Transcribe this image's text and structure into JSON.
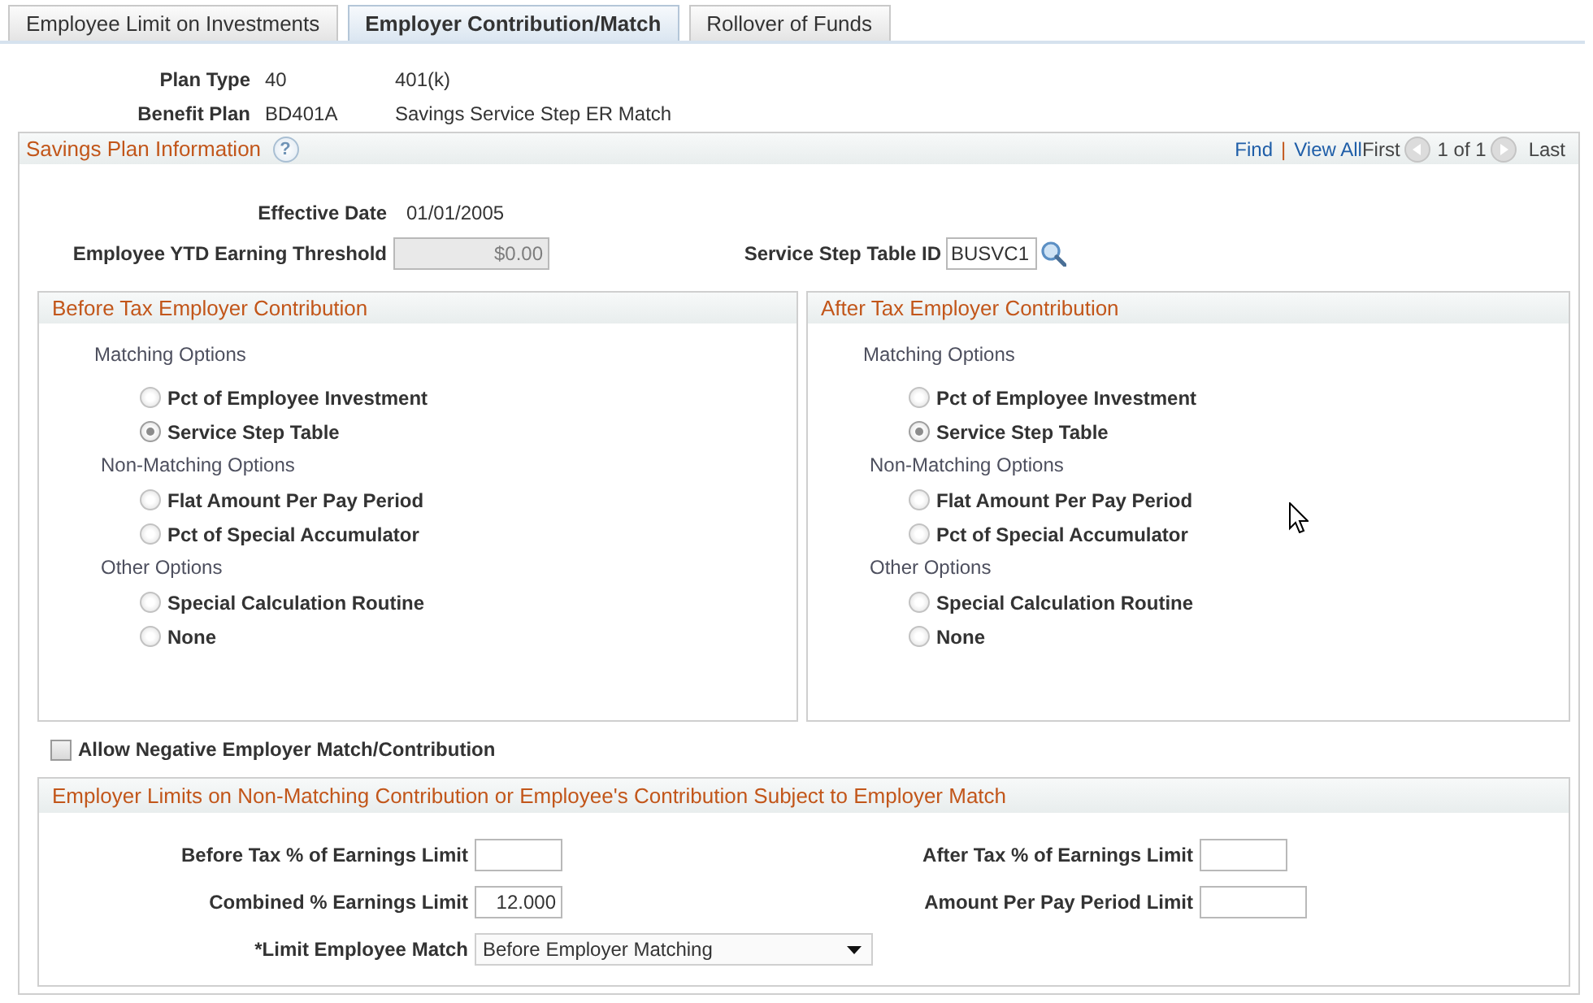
{
  "tabs": [
    {
      "label": "Employee Limit on Investments",
      "selected": false
    },
    {
      "label": "Employer Contribution/Match",
      "selected": true
    },
    {
      "label": "Rollover of Funds",
      "selected": false
    }
  ],
  "plan_info": [
    {
      "label": "Plan Type",
      "code": "40",
      "description": "401(k)"
    },
    {
      "label": "Benefit Plan",
      "code": "BD401A",
      "description": "Savings Service Step ER Match"
    }
  ],
  "savings_plan": {
    "title": "Savings Plan Information",
    "help": "?",
    "navigation": {
      "find": "Find",
      "separator": "|",
      "view_all": "View All",
      "first": "First",
      "position": "1 of 1",
      "last": "Last"
    },
    "effective_date": {
      "label": "Effective Date",
      "value": "01/01/2005"
    },
    "ytd_threshold": {
      "label": "Employee YTD Earning Threshold",
      "value": "$0.00",
      "disabled": true
    },
    "service_step_table": {
      "label": "Service Step Table ID",
      "value": "BUSVC1"
    },
    "contribution_panels": [
      {
        "title": "Before Tax Employer Contribution",
        "groups": [
          {
            "label": "Matching Options",
            "options": [
              {
                "label": "Pct of Employee Investment",
                "selected": false
              },
              {
                "label": "Service Step Table",
                "selected": true
              }
            ]
          },
          {
            "label": "Non-Matching Options",
            "options": [
              {
                "label": "Flat Amount Per Pay Period",
                "selected": false
              },
              {
                "label": "Pct of Special Accumulator",
                "selected": false
              }
            ]
          },
          {
            "label": "Other Options",
            "options": [
              {
                "label": "Special Calculation Routine",
                "selected": false
              },
              {
                "label": "None",
                "selected": false
              }
            ]
          }
        ]
      },
      {
        "title": "After Tax Employer Contribution",
        "groups": [
          {
            "label": "Matching Options",
            "options": [
              {
                "label": "Pct of Employee Investment",
                "selected": false
              },
              {
                "label": "Service Step Table",
                "selected": true
              }
            ]
          },
          {
            "label": "Non-Matching Options",
            "options": [
              {
                "label": "Flat Amount Per Pay Period",
                "selected": false
              },
              {
                "label": "Pct of Special Accumulator",
                "selected": false
              }
            ]
          },
          {
            "label": "Other Options",
            "options": [
              {
                "label": "Special Calculation Routine",
                "selected": false
              },
              {
                "label": "None",
                "selected": false
              }
            ]
          }
        ]
      }
    ],
    "allow_negative": {
      "label": "Allow Negative Employer Match/Contribution",
      "checked": false
    },
    "limits": {
      "title": "Employer Limits on Non-Matching Contribution or Employee's Contribution Subject to Employer Match",
      "left_fields": [
        {
          "kind": "percent",
          "label": "Before Tax % of Earnings Limit"
        },
        {
          "kind": "percent",
          "label": "Combined % Earnings Limit",
          "value": "12.000"
        },
        {
          "kind": "dropdown",
          "label": "*Limit Employee Match",
          "value": "Before Employer Matching"
        }
      ],
      "right_fields": [
        {
          "kind": "percent",
          "label": "After Tax % of Earnings Limit"
        },
        {
          "kind": "amount",
          "label": "Amount Per Pay Period Limit"
        }
      ]
    }
  }
}
